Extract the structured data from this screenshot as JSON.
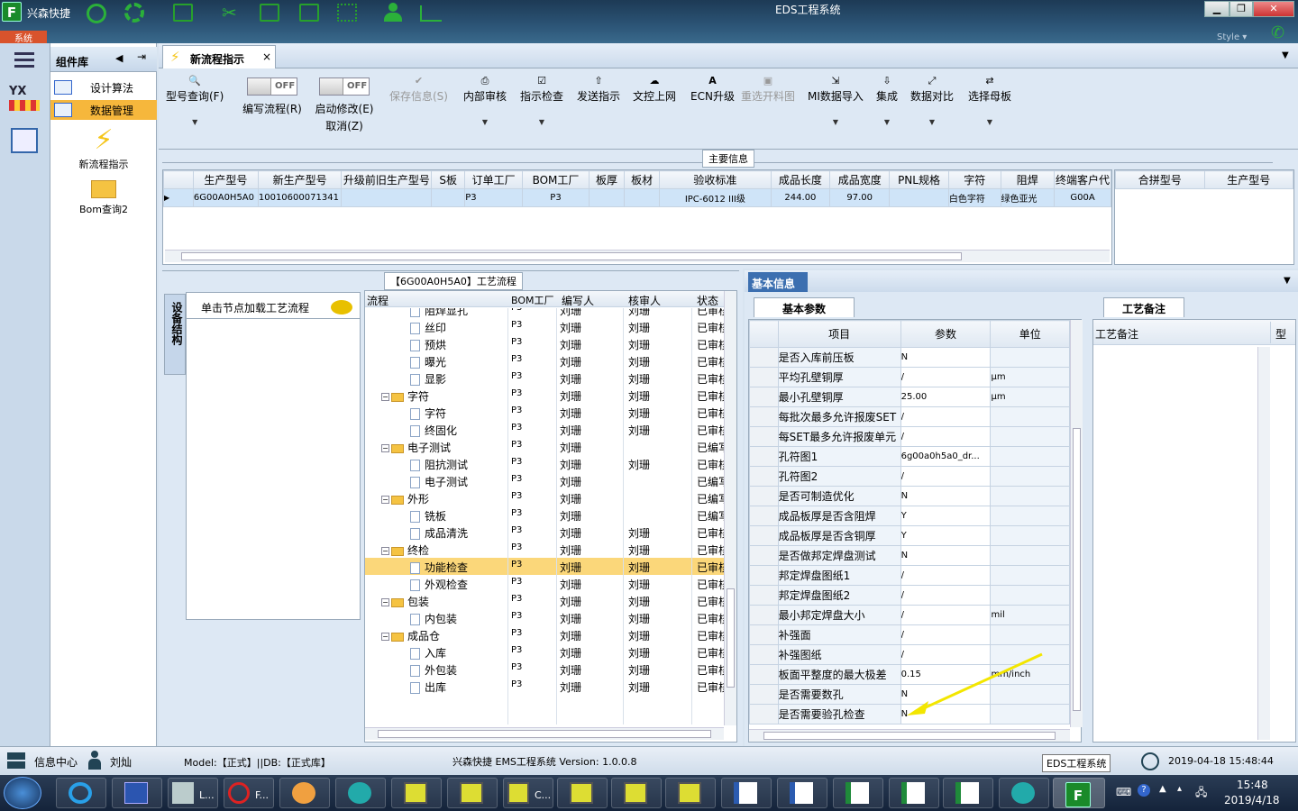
{
  "title_bar": {
    "app_name": "兴森快捷",
    "window_title": "EDS工程系统",
    "system_tab": "系统",
    "style_label": "Style ▾"
  },
  "sidebar": {
    "header": "组件库",
    "items": [
      {
        "label": "设计算法",
        "selected": false
      },
      {
        "label": "数据管理",
        "selected": true
      }
    ],
    "big_items": [
      {
        "label": "新流程指示",
        "icon": "lightning-icon"
      },
      {
        "label": "Bom查询2",
        "icon": "folder-open-icon"
      }
    ]
  },
  "doc_tab": {
    "label": "新流程指示",
    "close": "×"
  },
  "toolbar": {
    "buttons": [
      {
        "label": "型号查询(F)",
        "icon": "search-icon",
        "disabled": false,
        "dropdown": true
      },
      {
        "label": "保存信息(S)",
        "icon": "check-icon",
        "disabled": true,
        "dropdown": false
      },
      {
        "label": "内部审核",
        "icon": "printer-icon",
        "disabled": false,
        "dropdown": true
      },
      {
        "label": "指示检查",
        "icon": "check-box-icon",
        "disabled": false,
        "dropdown": true
      },
      {
        "label": "发送指示",
        "icon": "upload-icon",
        "disabled": false,
        "dropdown": false
      },
      {
        "label": "文控上网",
        "icon": "cloud-upload-icon",
        "disabled": false,
        "dropdown": false
      },
      {
        "label": "ECN升级",
        "icon": "ecn-icon",
        "disabled": false,
        "dropdown": false
      },
      {
        "label": "重选开料图",
        "icon": "image-icon",
        "disabled": true,
        "dropdown": false
      },
      {
        "label": "MI数据导入",
        "icon": "import-icon",
        "disabled": false,
        "dropdown": true
      },
      {
        "label": "集成",
        "icon": "download-icon",
        "disabled": false,
        "dropdown": true
      },
      {
        "label": "数据对比",
        "icon": "compare-icon",
        "disabled": false,
        "dropdown": true
      },
      {
        "label": "选择母板",
        "icon": "shuffle-icon",
        "disabled": false,
        "dropdown": true
      }
    ],
    "toggles": [
      {
        "label": "编写流程(R)",
        "state": "OFF"
      },
      {
        "label": "启动修改(E)",
        "label2": "取消(Z)",
        "state": "OFF"
      }
    ]
  },
  "main_info": {
    "title": "主要信息",
    "columns": [
      "生产型号",
      "新生产型号",
      "升级前旧生产型号",
      "S板",
      "订单工厂",
      "BOM工厂",
      "板厚",
      "板材",
      "验收标准",
      "成品长度",
      "成品宽度",
      "PNL规格",
      "字符",
      "阻焊",
      "终端客户代"
    ],
    "row": [
      "6G00A0H5A0",
      "10010600071341",
      "",
      "",
      "P3",
      "P3",
      "",
      "",
      "IPC-6012 III级",
      "244.00",
      "97.00",
      "",
      "白色字符",
      "绿色亚光",
      "G00A"
    ],
    "side_columns": [
      "合拼型号",
      "生产型号"
    ]
  },
  "process": {
    "title": "【6G00A0H5A0】工艺流程",
    "vertical_tab": "设备结构",
    "hint": "单击节点加载工艺流程",
    "columns": [
      "流程",
      "BOM工厂",
      "编写人",
      "核审人",
      "状态"
    ],
    "rows": [
      {
        "name": "阻焊显孔",
        "level": 2,
        "type": "doc",
        "bom": "P3",
        "writer": "刘珊",
        "reviewer": "刘珊",
        "status": "已审核",
        "partial": true
      },
      {
        "name": "丝印",
        "level": 2,
        "type": "doc",
        "bom": "P3",
        "writer": "刘珊",
        "reviewer": "刘珊",
        "status": "已审核"
      },
      {
        "name": "预烘",
        "level": 2,
        "type": "doc",
        "bom": "P3",
        "writer": "刘珊",
        "reviewer": "刘珊",
        "status": "已审核"
      },
      {
        "name": "曝光",
        "level": 2,
        "type": "doc",
        "bom": "P3",
        "writer": "刘珊",
        "reviewer": "刘珊",
        "status": "已审核"
      },
      {
        "name": "显影",
        "level": 2,
        "type": "doc",
        "bom": "P3",
        "writer": "刘珊",
        "reviewer": "刘珊",
        "status": "已审核"
      },
      {
        "name": "字符",
        "level": 1,
        "type": "folder",
        "bom": "P3",
        "writer": "刘珊",
        "reviewer": "刘珊",
        "status": "已审核"
      },
      {
        "name": "字符",
        "level": 2,
        "type": "doc",
        "bom": "P3",
        "writer": "刘珊",
        "reviewer": "刘珊",
        "status": "已审核"
      },
      {
        "name": "终固化",
        "level": 2,
        "type": "doc",
        "bom": "P3",
        "writer": "刘珊",
        "reviewer": "刘珊",
        "status": "已审核"
      },
      {
        "name": "电子测试",
        "level": 1,
        "type": "folder",
        "bom": "P3",
        "writer": "刘珊",
        "reviewer": "",
        "status": "已编写"
      },
      {
        "name": "阻抗测试",
        "level": 2,
        "type": "doc",
        "bom": "P3",
        "writer": "刘珊",
        "reviewer": "刘珊",
        "status": "已审核"
      },
      {
        "name": "电子测试",
        "level": 2,
        "type": "doc",
        "bom": "P3",
        "writer": "刘珊",
        "reviewer": "",
        "status": "已编写"
      },
      {
        "name": "外形",
        "level": 1,
        "type": "folder",
        "bom": "P3",
        "writer": "刘珊",
        "reviewer": "",
        "status": "已编写"
      },
      {
        "name": "铣板",
        "level": 2,
        "type": "doc",
        "bom": "P3",
        "writer": "刘珊",
        "reviewer": "",
        "status": "已编写"
      },
      {
        "name": "成品清洗",
        "level": 2,
        "type": "doc",
        "bom": "P3",
        "writer": "刘珊",
        "reviewer": "刘珊",
        "status": "已审核"
      },
      {
        "name": "终检",
        "level": 1,
        "type": "folder",
        "bom": "P3",
        "writer": "刘珊",
        "reviewer": "刘珊",
        "status": "已审核"
      },
      {
        "name": "功能检查",
        "level": 2,
        "type": "doc",
        "bom": "P3",
        "writer": "刘珊",
        "reviewer": "刘珊",
        "status": "已审核",
        "selected": true
      },
      {
        "name": "外观检查",
        "level": 2,
        "type": "doc",
        "bom": "P3",
        "writer": "刘珊",
        "reviewer": "刘珊",
        "status": "已审核"
      },
      {
        "name": "包装",
        "level": 1,
        "type": "folder",
        "bom": "P3",
        "writer": "刘珊",
        "reviewer": "刘珊",
        "status": "已审核"
      },
      {
        "name": "内包装",
        "level": 2,
        "type": "doc",
        "bom": "P3",
        "writer": "刘珊",
        "reviewer": "刘珊",
        "status": "已审核"
      },
      {
        "name": "成品仓",
        "level": 1,
        "type": "folder",
        "bom": "P3",
        "writer": "刘珊",
        "reviewer": "刘珊",
        "status": "已审核"
      },
      {
        "name": "入库",
        "level": 2,
        "type": "doc",
        "bom": "P3",
        "writer": "刘珊",
        "reviewer": "刘珊",
        "status": "已审核"
      },
      {
        "name": "外包装",
        "level": 2,
        "type": "doc",
        "bom": "P3",
        "writer": "刘珊",
        "reviewer": "刘珊",
        "status": "已审核"
      },
      {
        "name": "出库",
        "level": 2,
        "type": "doc",
        "bom": "P3",
        "writer": "刘珊",
        "reviewer": "刘珊",
        "status": "已审核"
      }
    ]
  },
  "basic_info": {
    "title": "基本信息",
    "tab": "基本参数",
    "columns": [
      "项目",
      "参数",
      "单位"
    ],
    "rows": [
      [
        "是否入库前压板",
        "N",
        ""
      ],
      [
        "平均孔壁铜厚",
        "/",
        "μm"
      ],
      [
        "最小孔壁铜厚",
        "25.00",
        "μm"
      ],
      [
        "每批次最多允许报废SET",
        "/",
        ""
      ],
      [
        "每SET最多允许报废单元",
        "/",
        ""
      ],
      [
        "孔符图1",
        "6g00a0h5a0_dr...",
        ""
      ],
      [
        "孔符图2",
        "/",
        ""
      ],
      [
        "是否可制造优化",
        "N",
        ""
      ],
      [
        "成品板厚是否含阻焊",
        "Y",
        ""
      ],
      [
        "成品板厚是否含铜厚",
        "Y",
        ""
      ],
      [
        "是否做邦定焊盘测试",
        "N",
        ""
      ],
      [
        "邦定焊盘图纸1",
        "/",
        ""
      ],
      [
        "邦定焊盘图纸2",
        "/",
        ""
      ],
      [
        "最小邦定焊盘大小",
        "/",
        "mil"
      ],
      [
        "补强面",
        "/",
        ""
      ],
      [
        "补强图纸",
        "/",
        ""
      ],
      [
        "板面平整度的最大极差",
        "0.15",
        "mm/inch"
      ],
      [
        "是否需要数孔",
        "N",
        ""
      ],
      [
        "是否需要验孔检查",
        "N",
        ""
      ]
    ]
  },
  "craft_notes": {
    "tab": "工艺备注",
    "columns": [
      "工艺备注",
      "型"
    ]
  },
  "status_bar": {
    "info_center": "信息中心",
    "user": "刘灿",
    "model": "Model:【正式】||DB:【正式库】",
    "version": "兴森快捷 EMS工程系统 Version: 1.0.0.8",
    "tooltip": "EDS工程系统",
    "datetime": "2019-04-18 15:48:44"
  },
  "taskbar": {
    "apps": [
      "L...",
      "F...",
      "C..."
    ],
    "time": "15:48",
    "date": "2019/4/18"
  }
}
